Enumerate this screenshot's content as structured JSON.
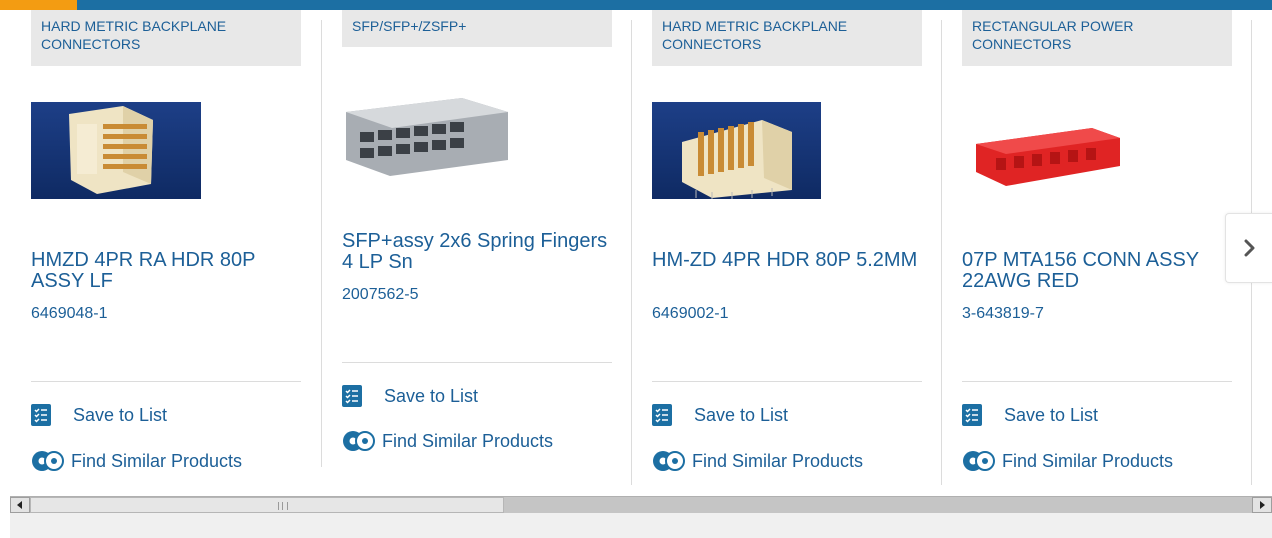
{
  "colors": {
    "brand_blue": "#1c6fa3",
    "accent_orange": "#f39c12",
    "link_text": "#1c5f97"
  },
  "products": [
    {
      "category": "HARD METRIC BACKPLANE CONNECTORS",
      "title": "HMZD 4PR RA HDR 80P ASSY LF",
      "part_number": "6469048-1",
      "save_label": "Save to List",
      "similar_label": "Find Similar Products"
    },
    {
      "category": "SFP/SFP+/ZSFP+",
      "title": "SFP+assy 2x6 Spring Fingers 4 LP Sn",
      "part_number": "2007562-5",
      "save_label": "Save to List",
      "similar_label": "Find Similar Products"
    },
    {
      "category": "HARD METRIC BACKPLANE CONNECTORS",
      "title": "HM-ZD 4PR HDR 80P 5.2MM",
      "part_number": "6469002-1",
      "save_label": "Save to List",
      "similar_label": "Find Similar Products"
    },
    {
      "category": "RECTANGULAR POWER CONNECTORS",
      "title": "07P MTA156 CONN ASSY 22AWG RED",
      "part_number": "3-643819-7",
      "save_label": "Save to List",
      "similar_label": "Find Similar Products"
    }
  ],
  "carousel": {
    "next_icon": "chevron-right-icon"
  }
}
